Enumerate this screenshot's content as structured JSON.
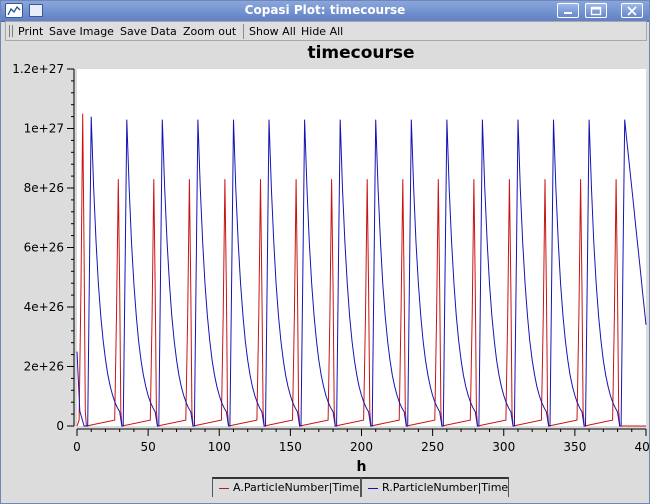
{
  "window": {
    "title": "Copasi Plot: timecourse"
  },
  "toolbar": {
    "print_label": "Print",
    "save_image_label": "Save Image",
    "save_data_label": "Save Data",
    "zoom_out_label": "Zoom out",
    "show_all_label": "Show All",
    "hide_all_label": "Hide All"
  },
  "colors": {
    "series_a": "#c81414",
    "series_r": "#1414b4",
    "titlebar": "#6f8fd0"
  },
  "chart_data": {
    "type": "line",
    "title": "timecourse",
    "xlabel": "h",
    "ylabel": "",
    "xlim": [
      0,
      400
    ],
    "ylim": [
      0,
      1.2e+27
    ],
    "x_ticks": [
      "0",
      "50",
      "100",
      "150",
      "200",
      "250",
      "300",
      "350",
      "400"
    ],
    "y_ticks": [
      "0",
      "2e+26",
      "4e+26",
      "6e+26",
      "8e+26",
      "1e+27",
      "1.2e+27"
    ],
    "grid": false,
    "legend_position": "bottom",
    "series": [
      {
        "name": "A.ParticleNumber|Time",
        "color": "#c81414",
        "peak_times": [
          4,
          29,
          54,
          79,
          104,
          129,
          154,
          179,
          204,
          229,
          254,
          279,
          304,
          329,
          354,
          379
        ],
        "peak_values": [
          1.05e+27,
          8.3e+26,
          8.3e+26,
          8.3e+26,
          8.3e+26,
          8.3e+26,
          8.3e+26,
          8.3e+26,
          8.3e+26,
          8.3e+26,
          8.3e+26,
          8.3e+26,
          8.3e+26,
          8.3e+26,
          8.3e+26,
          8.3e+26
        ],
        "baseline": 0
      },
      {
        "name": "R.ParticleNumber|Time",
        "color": "#1414b4",
        "peak_times": [
          10,
          35,
          60,
          85,
          110,
          135,
          160,
          185,
          210,
          235,
          260,
          285,
          310,
          335,
          360,
          385
        ],
        "peak_values": [
          1.04e+27,
          1.03e+27,
          1.03e+27,
          1.03e+27,
          1.03e+27,
          1.03e+27,
          1.03e+27,
          1.03e+27,
          1.03e+27,
          1.03e+27,
          1.03e+27,
          1.03e+27,
          1.03e+27,
          1.03e+27,
          1.03e+27,
          1.03e+27
        ],
        "final_value": 3.4e+26,
        "baseline": 0
      }
    ]
  }
}
